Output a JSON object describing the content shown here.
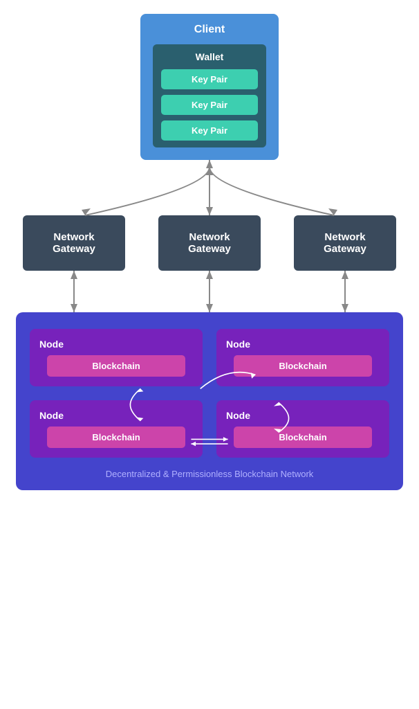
{
  "client": {
    "label": "Client",
    "wallet": {
      "label": "Wallet",
      "keyPairs": [
        "Key Pair",
        "Key Pair",
        "Key Pair"
      ]
    }
  },
  "gateways": [
    {
      "label": "Network Gateway"
    },
    {
      "label": "Network Gateway"
    },
    {
      "label": "Network Gateway"
    }
  ],
  "nodes": [
    {
      "label": "Node",
      "blockchain": "Blockchain"
    },
    {
      "label": "Node",
      "blockchain": "Blockchain"
    },
    {
      "label": "Node",
      "blockchain": "Blockchain"
    },
    {
      "label": "Node",
      "blockchain": "Blockchain"
    }
  ],
  "networkLabel": "Decentralized & Permissionless Blockchain Network",
  "colors": {
    "clientBg": "#4a90d9",
    "walletBg": "#2a5f6e",
    "keyPairBg": "#3dcfb0",
    "gatewayBg": "#3a4a5c",
    "networkBg": "#4444cc",
    "nodeBg": "#7722bb",
    "blockchainBg": "#cc44aa"
  }
}
